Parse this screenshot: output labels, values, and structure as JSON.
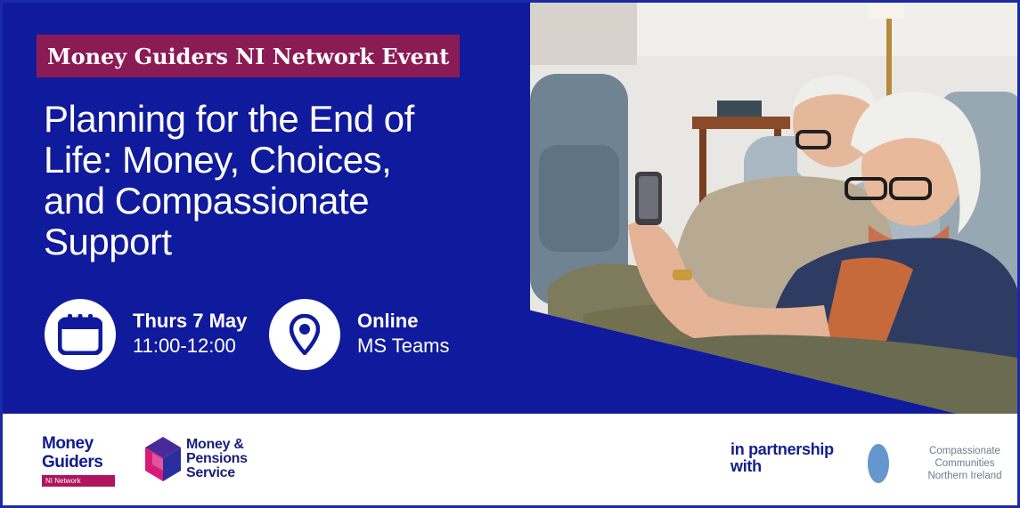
{
  "event": {
    "badge": "Money Guiders NI Network Event",
    "title_lines": [
      "Planning for the End of",
      "Life: Money, Choices,",
      "and Compassionate",
      "Support"
    ],
    "date": {
      "label": "Thurs 7 May",
      "time": "11:00-12:00"
    },
    "location": {
      "label": "Online",
      "detail": "MS Teams"
    }
  },
  "footer": {
    "money_guiders": {
      "line1": "Money",
      "line2": "Guiders",
      "tag": "NI Network"
    },
    "mps": {
      "line1": "Money &",
      "line2": "Pensions",
      "line3": "Service"
    },
    "partnership": {
      "line1": "in partnership",
      "line2": "with"
    },
    "compassionate": {
      "line1": "Compassionate",
      "line2": "Communities",
      "line3": "Northern Ireland"
    }
  },
  "colors": {
    "hero_blue": "#101a9c",
    "badge_maroon": "#8b1b55",
    "tag_pink": "#b0145e",
    "mps_purple": "#4a2a9a",
    "mps_pink": "#d81b7a",
    "cc_teal": "#39a9c9",
    "cc_purple": "#5e5bb8"
  },
  "icons": [
    "calendar-icon",
    "location-pin-icon"
  ]
}
